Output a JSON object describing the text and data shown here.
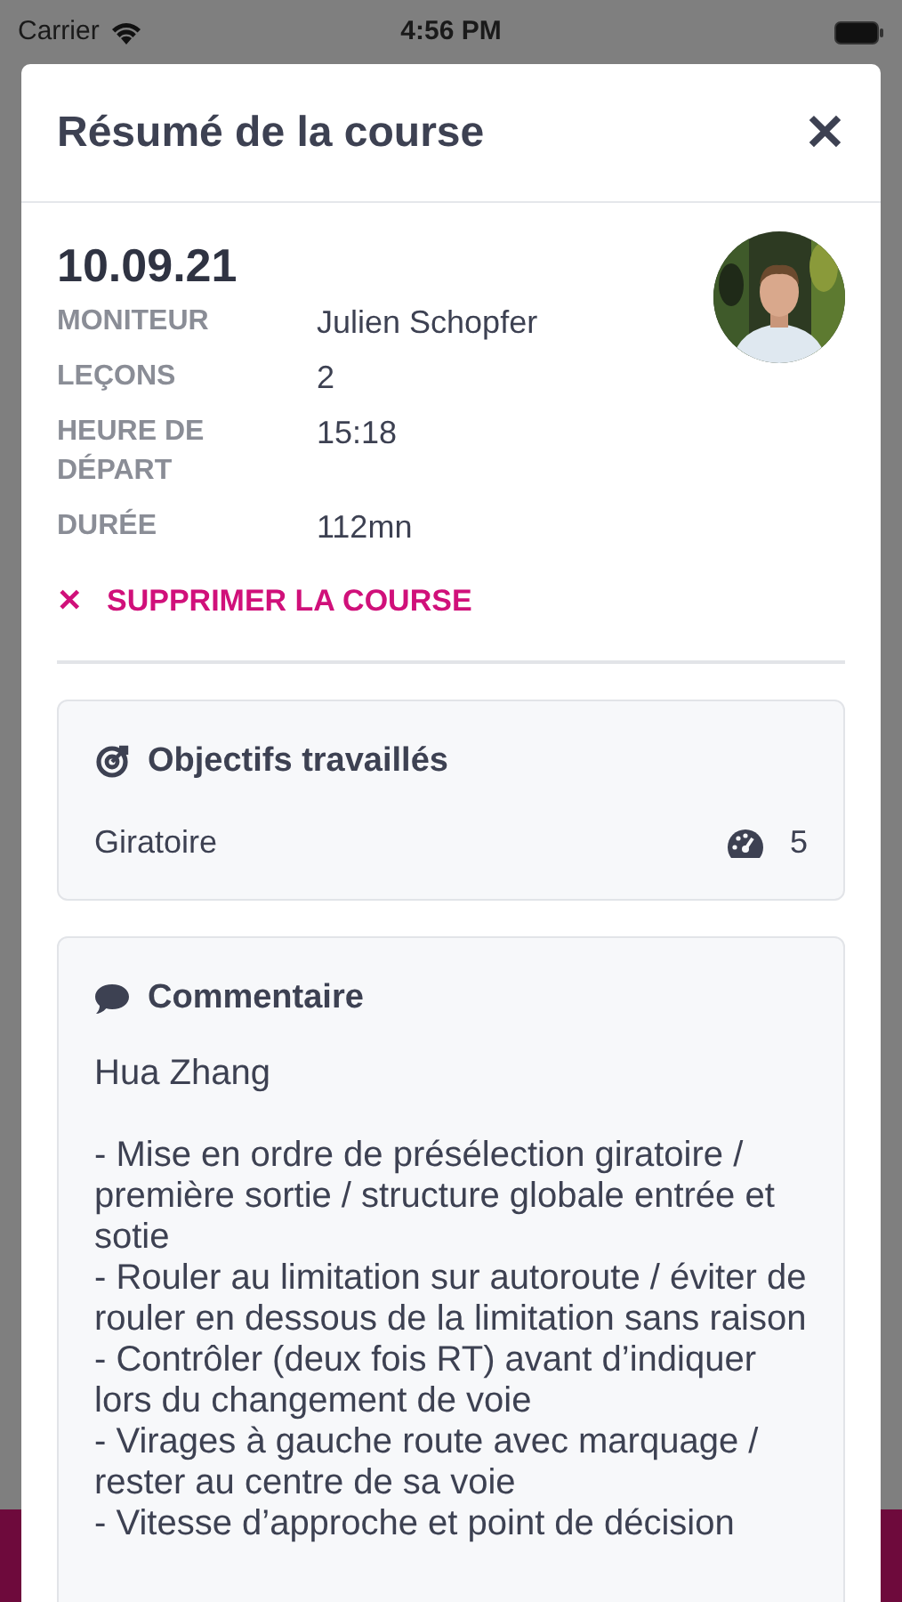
{
  "status_bar": {
    "carrier": "Carrier",
    "time": "4:56 PM"
  },
  "modal": {
    "title": "Résumé de la course",
    "close_label": "✕"
  },
  "course": {
    "date": "10.09.21",
    "details": [
      {
        "label": "MONITEUR",
        "value": "Julien Schopfer"
      },
      {
        "label": "LEÇONS",
        "value": "2"
      },
      {
        "label": "HEURE DE DÉPART",
        "value": "15:18"
      },
      {
        "label": "DURÉE",
        "value": "112mn"
      }
    ],
    "delete_action": {
      "icon": "✕",
      "label": "SUPPRIMER LA COURSE"
    }
  },
  "objectives": {
    "title": "Objectifs travaillés",
    "items": [
      {
        "name": "Giratoire",
        "score": "5"
      }
    ]
  },
  "comment": {
    "title": "Commentaire",
    "author": "Hua Zhang",
    "lines": [
      "- Mise en ordre de présélection giratoire / première sortie / structure globale entrée et sotie",
      "- Rouler au limitation sur autoroute / éviter de rouler en dessous de la limitation sans raison",
      "- Contrôler (deux fois RT) avant d’indiquer lors du changement de voie",
      "- Virages à gauche route avec marquage / rester au centre de sa voie",
      "- Vitesse d’approche et point de décision"
    ]
  }
}
